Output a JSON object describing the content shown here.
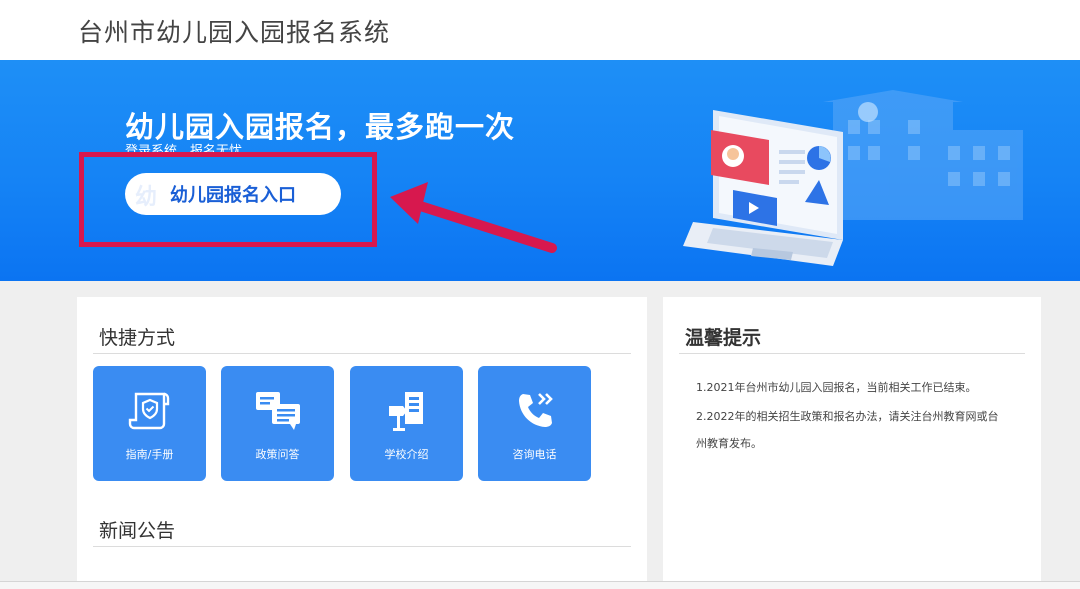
{
  "header": {
    "title": "台州市幼儿园入园报名系统"
  },
  "banner": {
    "title": "幼儿园入园报名，最多跑一次",
    "subtitle": "登录系统，报名无忧",
    "entry_button": "幼儿园报名入口",
    "entry_ghost": "幼"
  },
  "quick_links": {
    "title": "快捷方式",
    "items": [
      {
        "label": "指南/手册",
        "icon": "scroll-shield-icon"
      },
      {
        "label": "政策问答",
        "icon": "chat-bubbles-icon"
      },
      {
        "label": "学校介绍",
        "icon": "school-signpost-icon"
      },
      {
        "label": "咨询电话",
        "icon": "phone-call-icon"
      }
    ]
  },
  "news": {
    "title": "新闻公告"
  },
  "tips": {
    "title": "温馨提示",
    "lines": [
      "1.2021年台州市幼儿园入园报名，当前相关工作已结束。",
      "2.2022年的相关招生政策和报名办法，请关注台州教育网或台",
      "州教育发布。"
    ]
  },
  "colors": {
    "banner": "#1583f5",
    "tile": "#3a8cf2",
    "highlight": "#d7184e",
    "button_text": "#1a5fd6"
  }
}
